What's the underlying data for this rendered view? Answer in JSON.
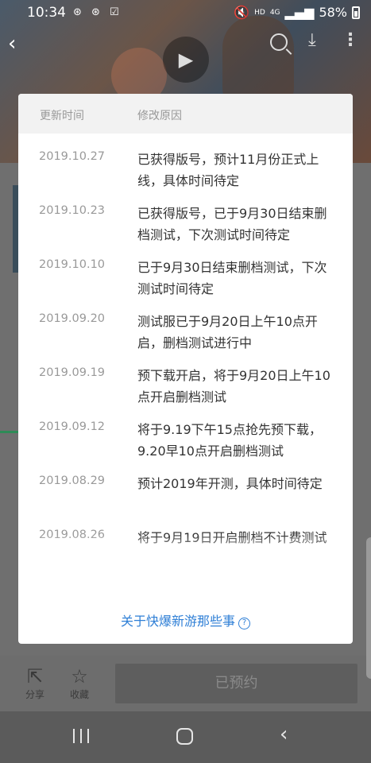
{
  "status_bar": {
    "time": "10:34",
    "notif_icons": "weibo-icon weibo-icon check-icon",
    "hd": "HD",
    "network": "4G",
    "battery": "58%"
  },
  "bottom_bar": {
    "share_label": "分享",
    "fav_label": "收藏",
    "reserve_label": "已预约"
  },
  "dialog": {
    "header_date": "更新时间",
    "header_reason": "修改原因",
    "records": [
      {
        "date": "2019.10.27",
        "reason": "已获得版号，预计11月份正式上线，具体时间待定"
      },
      {
        "date": "2019.10.23",
        "reason": "已获得版号，已于9月30日结束删档测试，下次测试时间待定"
      },
      {
        "date": "2019.10.10",
        "reason": "已于9月30日结束删档测试，下次测试时间待定"
      },
      {
        "date": "2019.09.20",
        "reason": "测试服已于9月20日上午10点开启，删档测试进行中"
      },
      {
        "date": "2019.09.19",
        "reason": "预下载开启，将于9月20日上午10点开启删档测试"
      },
      {
        "date": "2019.09.12",
        "reason": "将于9.19下午15点抢先预下载，9.20早10点开启删档测试"
      },
      {
        "date": "2019.08.29",
        "reason": "预计2019年开测，具体时间待定"
      },
      {
        "date": "2019.08.26",
        "reason": "将于9月19日开启删档不计费测试"
      }
    ],
    "about_link": "关于快爆新游那些事",
    "about_icon": "?"
  },
  "colors": {
    "link": "#2f7fd6",
    "overlay": "#555555",
    "accent_green": "#2e8b57"
  }
}
